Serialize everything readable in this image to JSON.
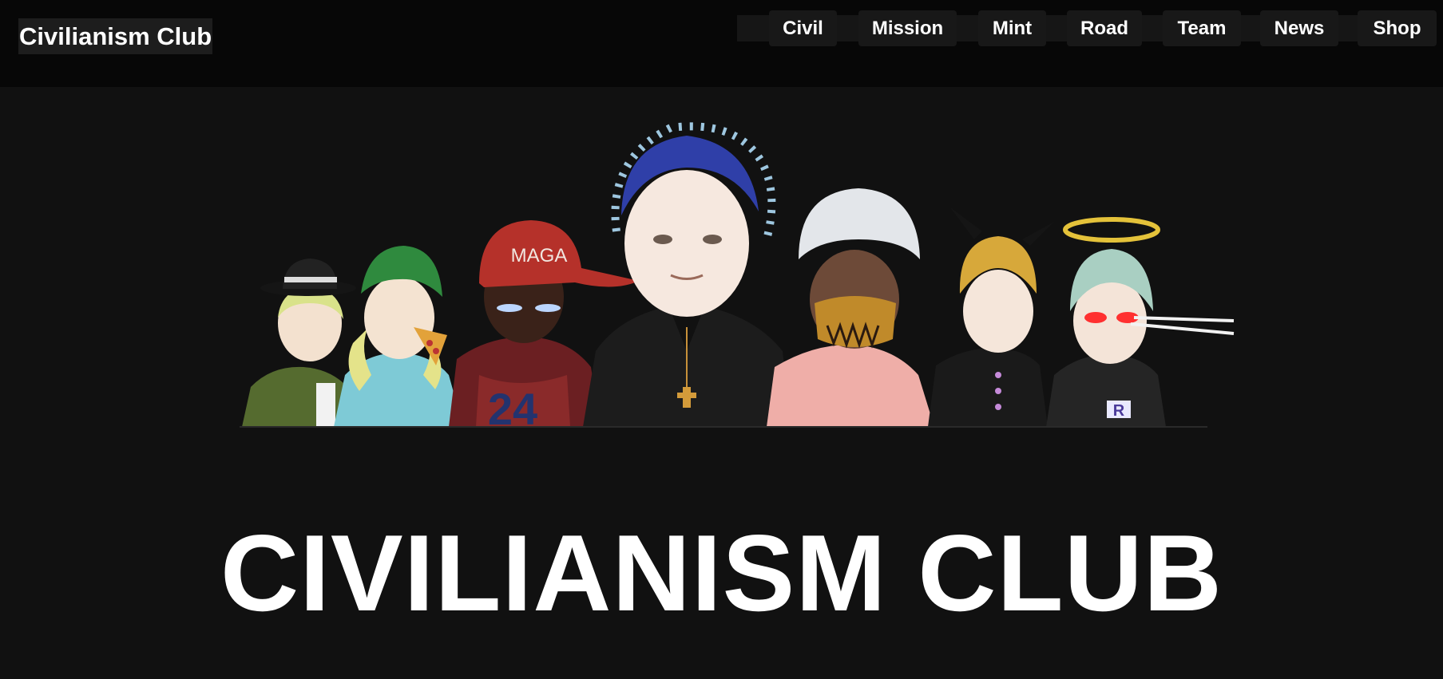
{
  "header": {
    "brand": "Civilianism Club",
    "nav": [
      {
        "label": "Civil"
      },
      {
        "label": "Mission"
      },
      {
        "label": "Mint"
      },
      {
        "label": "Road"
      },
      {
        "label": "Team"
      },
      {
        "label": "News"
      },
      {
        "label": "Shop"
      }
    ]
  },
  "hero": {
    "hat_text": "MAGA",
    "jersey_number": "24",
    "shirt_logo": "R"
  },
  "main": {
    "title": "CIVILIANISM CLUB"
  },
  "colors": {
    "page_background": "#111111",
    "header_background": "#070707",
    "text": "#ffffff",
    "nav_button_background": "#181818"
  }
}
